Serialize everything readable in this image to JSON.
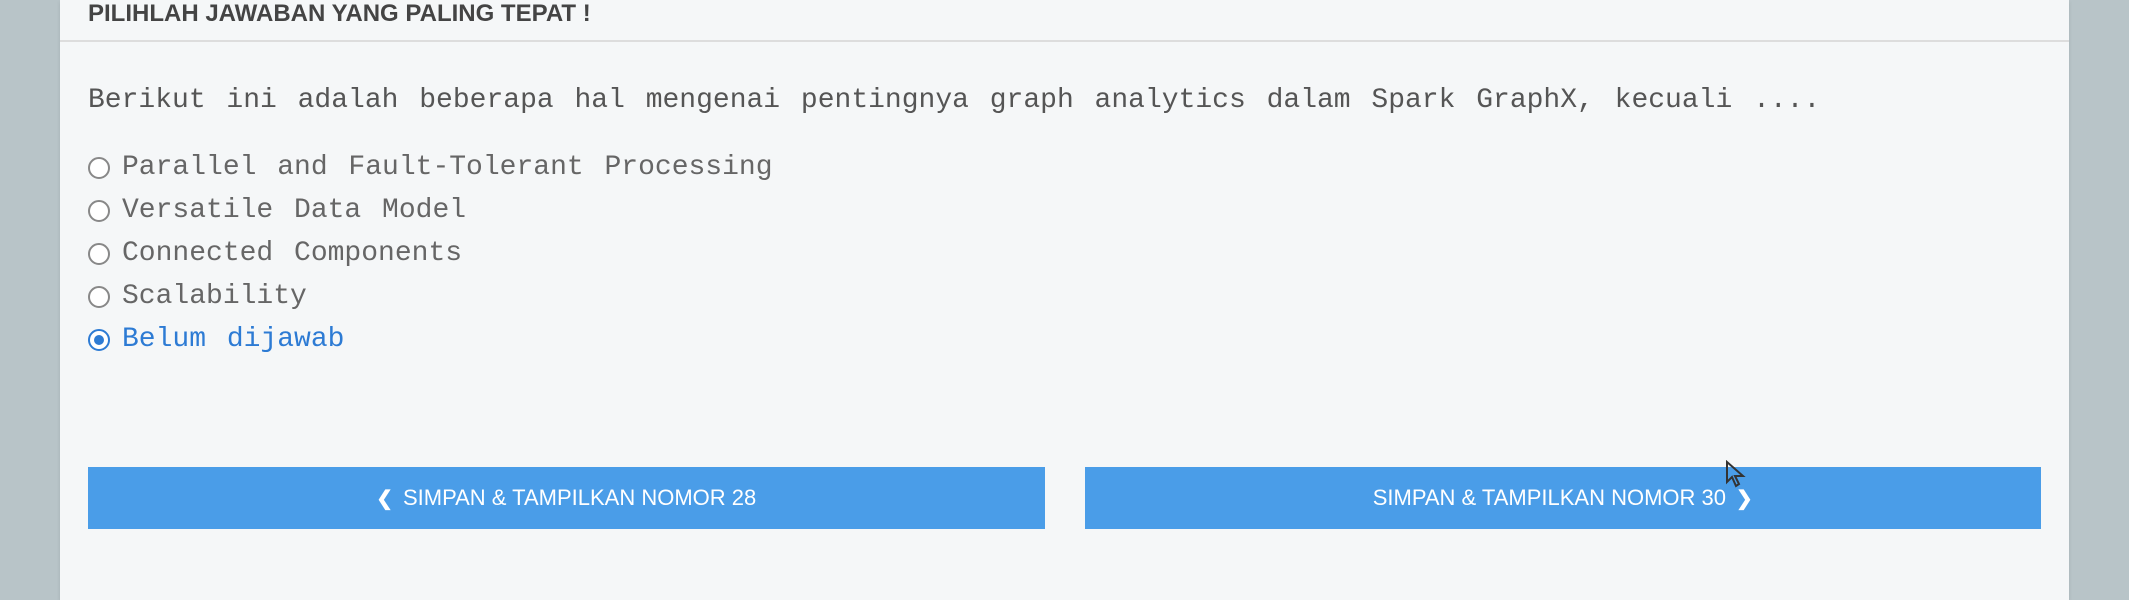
{
  "instruction": "PILIHLAH JAWABAN YANG PALING TEPAT !",
  "question": "Berikut ini adalah beberapa hal mengenai pentingnya graph analytics dalam Spark GraphX, kecuali ....",
  "options": [
    {
      "label": "Parallel and Fault-Tolerant Processing",
      "selected": false
    },
    {
      "label": "Versatile Data Model",
      "selected": false
    },
    {
      "label": "Connected Components",
      "selected": false
    },
    {
      "label": "Scalability",
      "selected": false
    },
    {
      "label": "Belum dijawab",
      "selected": true
    }
  ],
  "nav": {
    "prev_label": "SIMPAN & TAMPILKAN NOMOR 28",
    "next_label": "SIMPAN & TAMPILKAN NOMOR 30"
  }
}
